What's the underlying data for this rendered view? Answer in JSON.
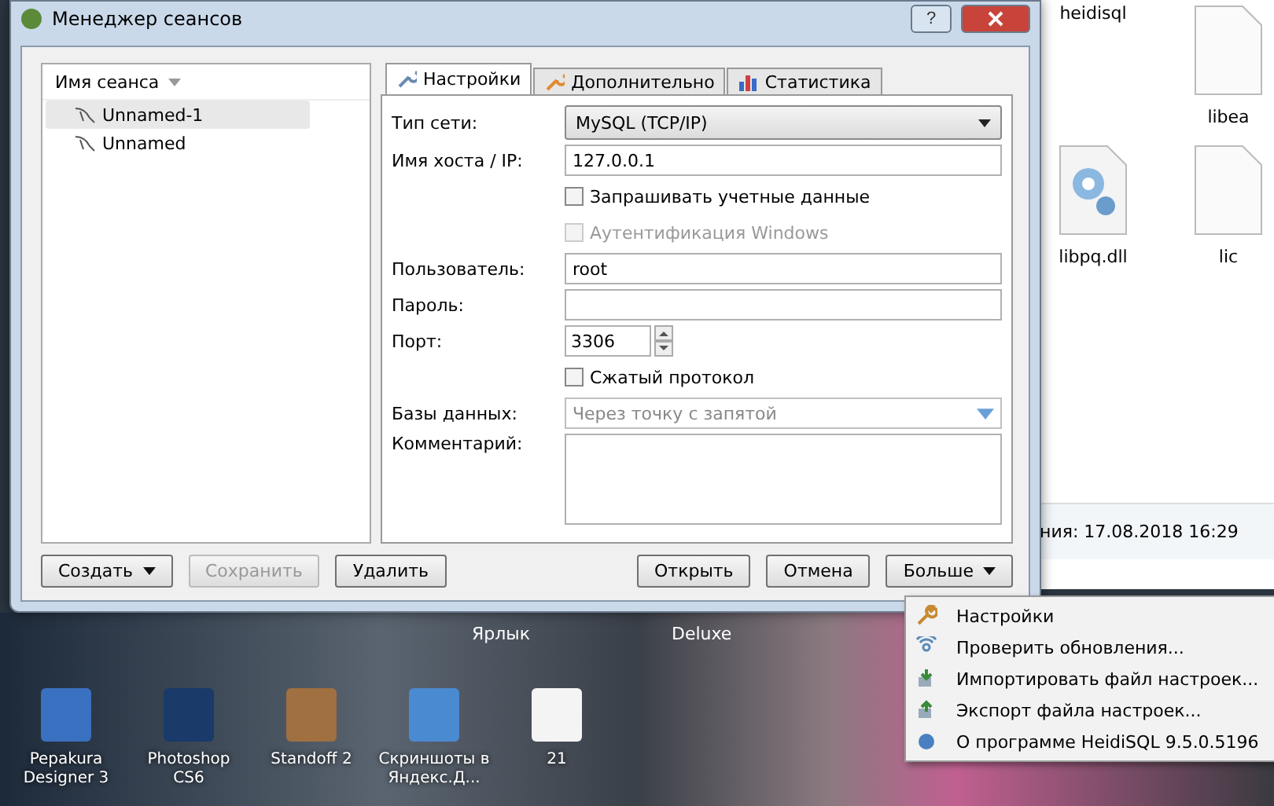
{
  "dialog": {
    "title": "Менеджер сеансов",
    "help": "?"
  },
  "sessions": {
    "header": "Имя сеанса",
    "items": [
      {
        "label": "Unnamed-1",
        "selected": true
      },
      {
        "label": "Unnamed",
        "selected": false
      }
    ]
  },
  "tabs": [
    {
      "label": "Настройки",
      "selected": true
    },
    {
      "label": "Дополнительно",
      "selected": false
    },
    {
      "label": "Статистика",
      "selected": false
    }
  ],
  "fields": [
    {
      "kind": "select",
      "label": "Тип сети:",
      "value": "MySQL (TCP/IP)"
    },
    {
      "kind": "text",
      "label": "Имя хоста / IP:",
      "value": "127.0.0.1"
    },
    {
      "kind": "checkbox",
      "label": "Запрашивать учетные данные",
      "checked": false,
      "disabled": false
    },
    {
      "kind": "checkbox",
      "label": "Аутентификация Windows",
      "checked": false,
      "disabled": true
    },
    {
      "kind": "text",
      "label": "Пользователь:",
      "value": "root"
    },
    {
      "kind": "text",
      "label": "Пароль:"
    },
    {
      "kind": "spin",
      "label": "Порт:",
      "value": "3306"
    },
    {
      "kind": "checkbox",
      "label": "Сжатый протокол",
      "checked": false,
      "disabled": false
    },
    {
      "kind": "combo",
      "label": "Базы данных:",
      "placeholder": "Через точку с запятой"
    },
    {
      "kind": "memo",
      "label": "Комментарий:"
    }
  ],
  "left_buttons": [
    {
      "label": "Создать",
      "split": true,
      "disabled": false
    },
    {
      "label": "Сохранить",
      "split": false,
      "disabled": true
    },
    {
      "label": "Удалить",
      "split": false,
      "disabled": false
    }
  ],
  "right_buttons": [
    {
      "label": "Открыть",
      "split": false,
      "disabled": false
    },
    {
      "label": "Отмена",
      "split": false,
      "disabled": false
    },
    {
      "label": "Больше",
      "split": true,
      "disabled": false
    }
  ],
  "menu": [
    {
      "label": "Настройки"
    },
    {
      "label": "Проверить обновления..."
    },
    {
      "label": "Импортировать файл настроек..."
    },
    {
      "label": "Экспорт файла настроек..."
    },
    {
      "label": "О программе HeidiSQL 9.5.0.5196"
    }
  ],
  "explorer": {
    "files": [
      {
        "label": "heidisql"
      },
      {
        "label": "libea"
      },
      {
        "label": "libpq.dll"
      },
      {
        "label": "lic"
      }
    ],
    "status": "ния:  17.08.2018 16:29"
  },
  "desktop": {
    "captions": [
      "Ярлык",
      "Deluxe"
    ],
    "icons": [
      {
        "label": "Pepakura Designer 3"
      },
      {
        "label": "Photoshop CS6"
      },
      {
        "label": "Standoff 2"
      },
      {
        "label": "Скриншоты в Яндекс.Д..."
      },
      {
        "label": "21"
      }
    ]
  }
}
